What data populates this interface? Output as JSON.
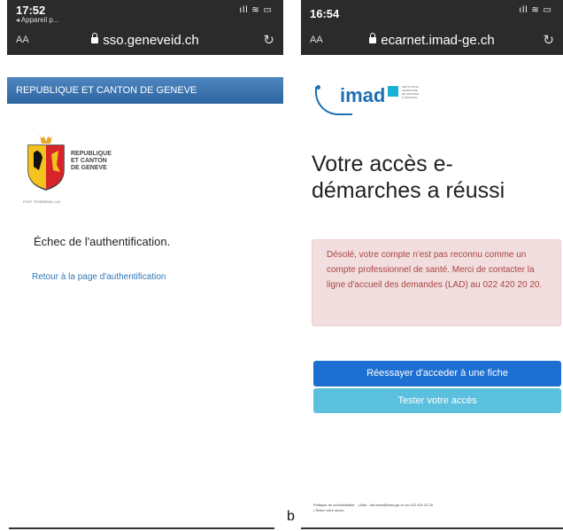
{
  "phoneA": {
    "status": {
      "time": "17:52",
      "back_app": "◂ Appareil p...",
      "signal": "ıll ≋ ▭"
    },
    "browser": {
      "aa": "AA",
      "url": "sso.geneveid.ch",
      "reload": "↻"
    },
    "banner": "REPUBLIQUE ET CANTON DE GENEVE",
    "logo_text": [
      "REPUBLIQUE",
      "ET CANTON",
      "DE GENEVE"
    ],
    "motto": "POST TENEBRAS LUX",
    "message": "Échec de l'authentification.",
    "link": "Retour à la page d'authentification"
  },
  "phoneB": {
    "status": {
      "time": "16:54",
      "signal": "ıll ≋ ▭"
    },
    "browser": {
      "aa": "AA",
      "url": "ecarnet.imad-ge.ch",
      "reload": "↻"
    },
    "logo": {
      "word": "imad",
      "subtitle": [
        "INSTITUTION",
        "GENEVOISE",
        "DE MAINTIEN",
        "À DOMICILE"
      ]
    },
    "title": "Votre accès e-démarches a réussi",
    "alert": "Désolé, votre compte n'est pas reconnu comme un compte professionnel de santé. Merci de contacter la ligne d'accueil des demandes (LAD) au 022 420 20 20.",
    "button_retry": "Réessayer d'acceder à une fiche",
    "button_test": "Tester votre accès",
    "footer": {
      "privacy": "Politique de confidentialité",
      "help": "Aide : lad.imad@imad-ge.ch ou 022 420 20 20",
      "test": "Tester votre accès"
    }
  },
  "label_b": "b",
  "colors": {
    "banner": "#3a74b2",
    "imad_blue": "#1e6fb3",
    "alert_bg": "#f2dede",
    "alert_text": "#a94442",
    "primary_btn": "#1e6fd2",
    "info_btn": "#5bc0de"
  }
}
